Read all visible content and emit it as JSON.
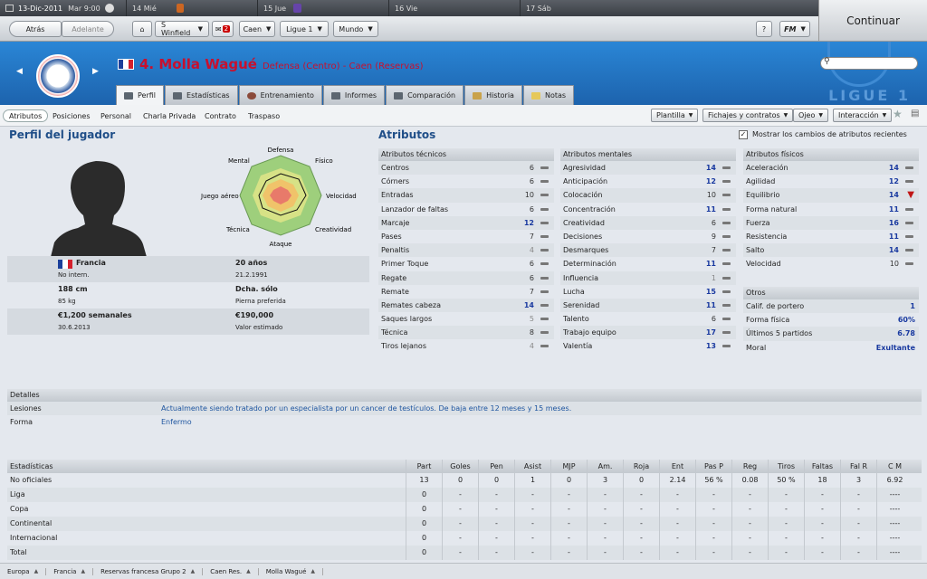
{
  "topbar": {
    "date": "13-Dic-2011",
    "weekday_time": "Mar 9:00",
    "days": [
      {
        "label": "14 Mié"
      },
      {
        "label": "15 Jue"
      },
      {
        "label": "16 Vie"
      },
      {
        "label": "17 Sáb"
      }
    ]
  },
  "toolbar": {
    "back": "Atrás",
    "forward": "Adelante",
    "manager": "S Winfield",
    "mail_count": "2",
    "club": "Caen",
    "league": "Ligue 1",
    "world": "Mundo",
    "help": "?",
    "fm": "FM",
    "continue": "Continuar"
  },
  "banner": {
    "number_name": "4. Molla Wagué",
    "position_team": "Defensa (Centro) - Caen (Reservas)",
    "league_watermark": "LIGUE 1"
  },
  "tabs": [
    "Perfil",
    "Estadísticas",
    "Entrenamiento",
    "Informes",
    "Comparación",
    "Historia",
    "Notas"
  ],
  "subnav": [
    "Atributos",
    "Posiciones",
    "Personal",
    "Charla Privada",
    "Contrato",
    "Traspaso"
  ],
  "dropdowns": [
    "Plantilla",
    "Fichajes y contratos",
    "Ojeo",
    "Interacción"
  ],
  "profile": {
    "title": "Perfil del jugador",
    "radar_labels": [
      "Defensa",
      "Físico",
      "Velocidad",
      "Creatividad",
      "Ataque",
      "Técnica",
      "Juego aéreo",
      "Mental"
    ],
    "rows": [
      {
        "a": "Francia",
        "b": "No intern.",
        "c": "20 años",
        "d": "21.2.1991"
      },
      {
        "a": "188 cm",
        "b": "85 kg",
        "c": "Dcha. sólo",
        "d": "Pierna preferida"
      },
      {
        "a": "€1,200 semanales",
        "b": "30.6.2013",
        "c": "€190,000",
        "d": "Valor estimado"
      }
    ]
  },
  "attributes": {
    "title": "Atributos",
    "show_changes": "Mostrar los cambios de atributos recientes",
    "technical": {
      "header": "Atributos técnicos",
      "items": [
        {
          "name": "Centros",
          "value": "6"
        },
        {
          "name": "Córners",
          "value": "6"
        },
        {
          "name": "Entradas",
          "value": "10"
        },
        {
          "name": "Lanzador de faltas",
          "value": "6"
        },
        {
          "name": "Marcaje",
          "value": "12"
        },
        {
          "name": "Pases",
          "value": "7"
        },
        {
          "name": "Penaltis",
          "value": "4"
        },
        {
          "name": "Primer Toque",
          "value": "6"
        },
        {
          "name": "Regate",
          "value": "6"
        },
        {
          "name": "Remate",
          "value": "7"
        },
        {
          "name": "Remates cabeza",
          "value": "14"
        },
        {
          "name": "Saques largos",
          "value": "5"
        },
        {
          "name": "Técnica",
          "value": "8"
        },
        {
          "name": "Tiros lejanos",
          "value": "4"
        }
      ]
    },
    "mental": {
      "header": "Atributos mentales",
      "items": [
        {
          "name": "Agresividad",
          "value": "14"
        },
        {
          "name": "Anticipación",
          "value": "12"
        },
        {
          "name": "Colocación",
          "value": "10"
        },
        {
          "name": "Concentración",
          "value": "11"
        },
        {
          "name": "Creatividad",
          "value": "6"
        },
        {
          "name": "Decisiones",
          "value": "9"
        },
        {
          "name": "Desmarques",
          "value": "7"
        },
        {
          "name": "Determinación",
          "value": "11"
        },
        {
          "name": "Influencia",
          "value": "1"
        },
        {
          "name": "Lucha",
          "value": "15"
        },
        {
          "name": "Serenidad",
          "value": "11"
        },
        {
          "name": "Talento",
          "value": "6"
        },
        {
          "name": "Trabajo equipo",
          "value": "17"
        },
        {
          "name": "Valentía",
          "value": "13"
        }
      ]
    },
    "physical": {
      "header": "Atributos físicos",
      "items": [
        {
          "name": "Aceleración",
          "value": "14"
        },
        {
          "name": "Agilidad",
          "value": "12"
        },
        {
          "name": "Equilibrio",
          "value": "14"
        },
        {
          "name": "Forma natural",
          "value": "11"
        },
        {
          "name": "Fuerza",
          "value": "16"
        },
        {
          "name": "Resistencia",
          "value": "11"
        },
        {
          "name": "Salto",
          "value": "14"
        },
        {
          "name": "Velocidad",
          "value": "10"
        }
      ]
    },
    "others": {
      "header": "Otros",
      "items": [
        {
          "name": "Calif. de portero",
          "value": "1"
        },
        {
          "name": "Forma física",
          "value": "60%"
        },
        {
          "name": "Últimos 5 partidos",
          "value": "6.78"
        },
        {
          "name": "Moral",
          "value": "Exultante"
        }
      ]
    }
  },
  "details": {
    "header": "Detalles",
    "injury_label": "Lesiones",
    "injury_text": "Actualmente siendo tratado por un especialista por un cancer de testículos. De baja entre 12 meses y 15 meses.",
    "form_label": "Forma",
    "form_value": "Enfermo"
  },
  "stats": {
    "header": "Estadísticas",
    "columns": [
      "Part",
      "Goles",
      "Pen",
      "Asist",
      "MJP",
      "Am.",
      "Roja",
      "Ent",
      "Pas P",
      "Reg",
      "Tiros",
      "Faltas",
      "Fal R",
      "C M"
    ],
    "rows": [
      {
        "name": "No oficiales",
        "cells": [
          "13",
          "0",
          "0",
          "1",
          "0",
          "3",
          "0",
          "2.14",
          "56 %",
          "0.08",
          "50 %",
          "18",
          "3",
          "6.92"
        ]
      },
      {
        "name": "Liga",
        "cells": [
          "0",
          "-",
          "-",
          "-",
          "-",
          "-",
          "-",
          "-",
          "-",
          "-",
          "-",
          "-",
          "-",
          "----"
        ]
      },
      {
        "name": "Copa",
        "cells": [
          "0",
          "-",
          "-",
          "-",
          "-",
          "-",
          "-",
          "-",
          "-",
          "-",
          "-",
          "-",
          "-",
          "----"
        ]
      },
      {
        "name": "Continental",
        "cells": [
          "0",
          "-",
          "-",
          "-",
          "-",
          "-",
          "-",
          "-",
          "-",
          "-",
          "-",
          "-",
          "-",
          "----"
        ]
      },
      {
        "name": "Internacional",
        "cells": [
          "0",
          "-",
          "-",
          "-",
          "-",
          "-",
          "-",
          "-",
          "-",
          "-",
          "-",
          "-",
          "-",
          "----"
        ]
      },
      {
        "name": "Total",
        "cells": [
          "0",
          "-",
          "-",
          "-",
          "-",
          "-",
          "-",
          "-",
          "-",
          "-",
          "-",
          "-",
          "-",
          "----"
        ]
      }
    ]
  },
  "breadcrumbs": [
    "Europa",
    "Francia",
    "Reservas francesa Grupo 2",
    "Caen Res.",
    "Molla Wagué"
  ],
  "colors": {
    "banner": "#1d63ad",
    "name": "#c8102e",
    "high_value": "#1a3aa0",
    "decline": "#c01616"
  }
}
